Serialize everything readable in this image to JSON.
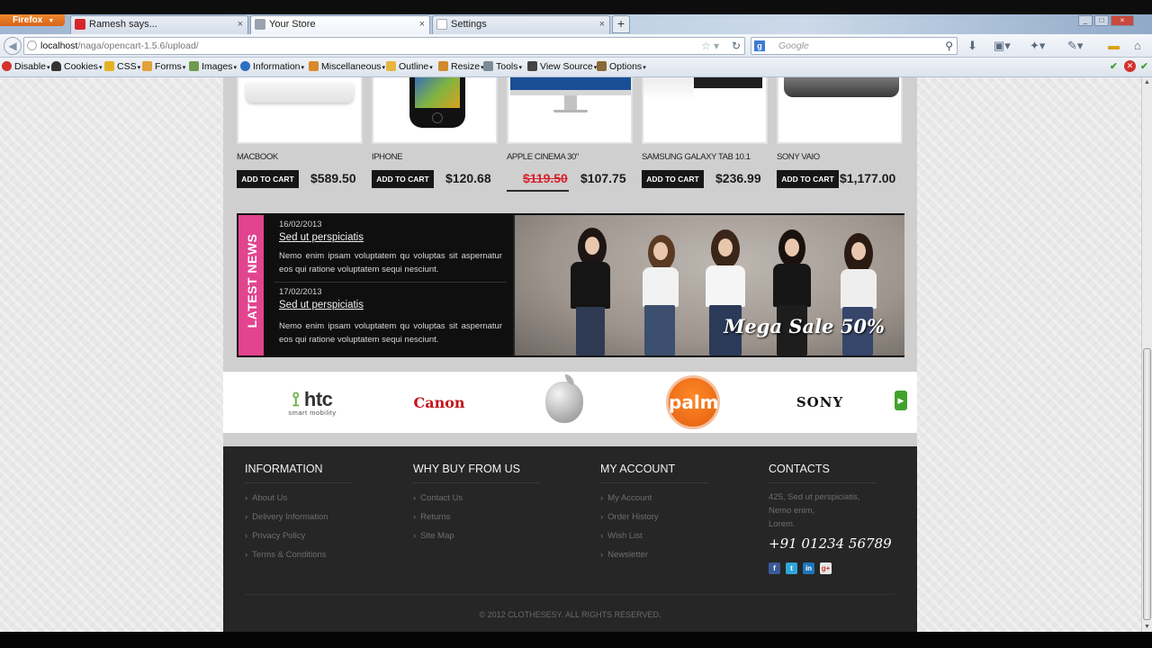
{
  "browser": {
    "app_button": "Firefox",
    "tabs": [
      {
        "title": "Ramesh says...",
        "favicon_color": "#d7262b"
      },
      {
        "title": "Your Store",
        "favicon_color": "#9aa3ad"
      },
      {
        "title": "Settings",
        "favicon_color": "#c8d0da"
      }
    ],
    "new_tab": "+",
    "url_host": "localhost",
    "url_path": "/naga/opencart-1.5.6/upload/",
    "search_placeholder": "Google"
  },
  "devtoolbar": {
    "items": [
      "Disable",
      "Cookies",
      "CSS",
      "Forms",
      "Images",
      "Information",
      "Miscellaneous",
      "Outline",
      "Resize",
      "Tools",
      "View Source",
      "Options"
    ]
  },
  "products": [
    {
      "name": "MACBOOK",
      "cart_label": "ADD TO CART",
      "price": "$589.50",
      "old_price": ""
    },
    {
      "name": "IPHONE",
      "cart_label": "ADD TO CART",
      "price": "$120.68",
      "old_price": ""
    },
    {
      "name": "APPLE CINEMA 30\"",
      "cart_label": "",
      "price": "$107.75",
      "old_price": "$119.50"
    },
    {
      "name": "SAMSUNG GALAXY TAB 10.1",
      "cart_label": "ADD TO CART",
      "price": "$236.99",
      "old_price": ""
    },
    {
      "name": "SONY VAIO",
      "cart_label": "ADD TO CART",
      "price": "$1,177.00",
      "old_price": ""
    }
  ],
  "news": {
    "heading": "LATEST NEWS",
    "items": [
      {
        "date": "16/02/2013",
        "title": "Sed ut perspiciatis",
        "text": "Nemo enim ipsam voluptatem qu voluptas sit aspernatur eos qui ratione voluptatem sequi nesciunt."
      },
      {
        "date": "17/02/2013",
        "title": "Sed ut perspiciatis",
        "text": "Nemo enim ipsam voluptatem qu voluptas sit aspernatur eos qui ratione voluptatem sequi nesciunt."
      }
    ],
    "banner_text": "Mega Sale 50%"
  },
  "brands": {
    "htc": "htc",
    "htc_sub": "smart mobility",
    "canon": "Canon",
    "palm": "palm",
    "sony": "SONY"
  },
  "footer": {
    "columns": [
      {
        "heading": "INFORMATION",
        "links": [
          "About Us",
          "Delivery Information",
          "Privacy Policy",
          "Terms & Conditions"
        ]
      },
      {
        "heading": "WHY BUY FROM US",
        "links": [
          "Contact Us",
          "Returns",
          "Site Map"
        ]
      },
      {
        "heading": "MY ACCOUNT",
        "links": [
          "My Account",
          "Order History",
          "Wish List",
          "Newsletter"
        ]
      }
    ],
    "contacts": {
      "heading": "CONTACTS",
      "address": [
        "425, Sed ut perspiciatis,",
        "Nemo enim,",
        "Lorem."
      ],
      "phone": "+91 01234 56789"
    },
    "copyright": "© 2012 CLOTHESESY. ALL RIGHTS RESERVED."
  },
  "colors": {
    "accent_pink": "#e2448f",
    "sale_red": "#d9202b",
    "footer_bg": "#262626"
  }
}
